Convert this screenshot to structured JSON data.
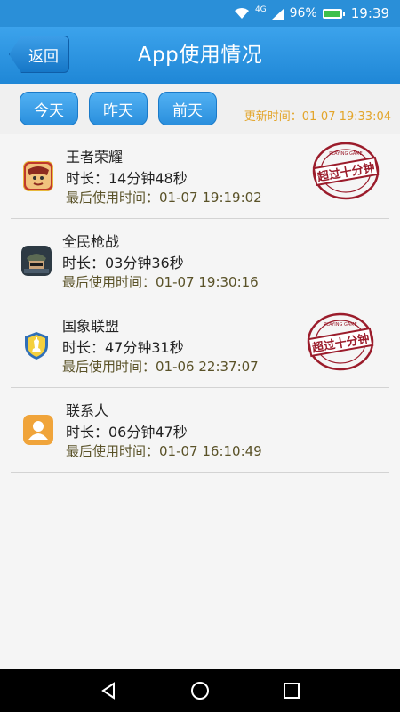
{
  "status_bar": {
    "network": "4G",
    "battery_percent": "96%",
    "battery_level": 0.96,
    "time": "19:39"
  },
  "header": {
    "back_label": "返回",
    "title": "App使用情况"
  },
  "day_tabs": [
    {
      "label": "今天"
    },
    {
      "label": "昨天"
    },
    {
      "label": "前天"
    }
  ],
  "update_time": "更新时间：01-07 19:33:04",
  "apps": [
    {
      "name": "王者荣耀",
      "duration": "时长：14分钟48秒",
      "last_used": "最后使用时间：01-07 19:19:02",
      "icon": "game-hero-icon",
      "over_limit": true
    },
    {
      "name": "全民枪战",
      "duration": "时长：03分钟36秒",
      "last_used": "最后使用时间：01-07 19:30:16",
      "icon": "game-soldier-icon",
      "over_limit": false
    },
    {
      "name": "国象联盟",
      "duration": "时长：47分钟31秒",
      "last_used": "最后使用时间：01-06 22:37:07",
      "icon": "chess-shield-icon",
      "over_limit": true
    },
    {
      "name": "联系人",
      "duration": "时长：06分钟47秒",
      "last_used": "最后使用时间：01-07 16:10:49",
      "icon": "contacts-icon",
      "over_limit": false
    }
  ],
  "stamp": {
    "main_text": "超过十分钟",
    "ring_text": "PLAYING GAME"
  },
  "colors": {
    "accent": "#2a8fd8",
    "update_time": "#e3a52a",
    "stamp": "#9b1c2b",
    "last_used_text": "#5a5228"
  }
}
